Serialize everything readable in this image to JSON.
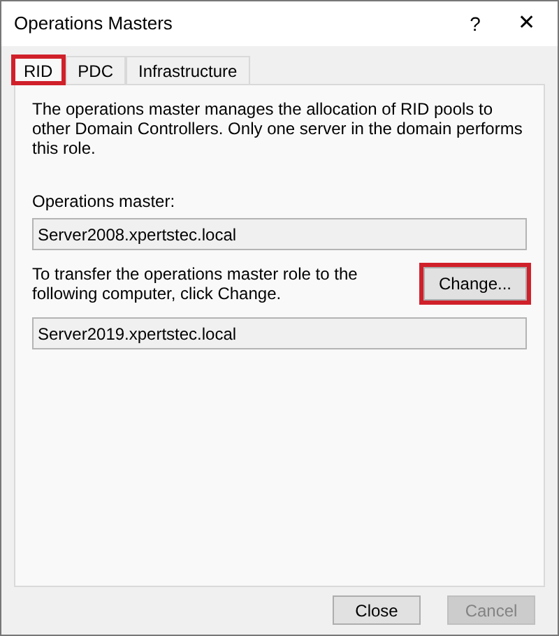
{
  "window": {
    "title": "Operations Masters",
    "help": "?",
    "close": "✕"
  },
  "tabs": [
    {
      "label": "RID",
      "selected": true,
      "highlighted": true
    },
    {
      "label": "PDC",
      "selected": false,
      "highlighted": false
    },
    {
      "label": "Infrastructure",
      "selected": false,
      "highlighted": false
    }
  ],
  "description": "The operations master manages the allocation of RID pools to other Domain Controllers. Only one server in the domain performs this role.",
  "operations_master": {
    "label": "Operations master:",
    "value": "Server2008.xpertstec.local"
  },
  "transfer": {
    "text": "To transfer the operations master role to the following computer, click Change.",
    "button": {
      "label": "Change...",
      "highlighted": true
    },
    "value": "Server2019.xpertstec.local"
  },
  "buttons": [
    {
      "label": "Close",
      "disabled": false
    },
    {
      "label": "Cancel",
      "disabled": true
    }
  ]
}
